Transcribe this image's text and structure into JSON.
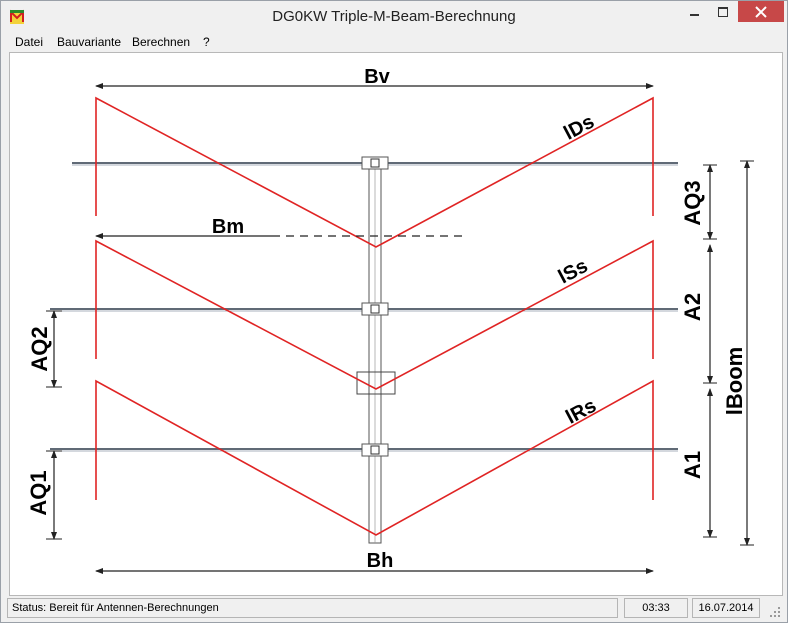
{
  "window": {
    "title": "DG0KW Triple-M-Beam-Berechnung"
  },
  "menu": {
    "items": [
      "Datei",
      "Bauvariante",
      "Berechnen",
      "?"
    ]
  },
  "diagram": {
    "labels": {
      "bv": "Bv",
      "bm": "Bm",
      "bh": "Bh",
      "ids": "lDs",
      "iss": "lSs",
      "irs": "lRs",
      "aq1": "AQ1",
      "aq2": "AQ2",
      "aq3": "AQ3",
      "a1": "A1",
      "a2": "A2",
      "iboom": "lBoom"
    }
  },
  "statusbar": {
    "status": "Status: Bereit für Antennen-Berechnungen",
    "time": "03:33",
    "date": "16.07.2014"
  }
}
